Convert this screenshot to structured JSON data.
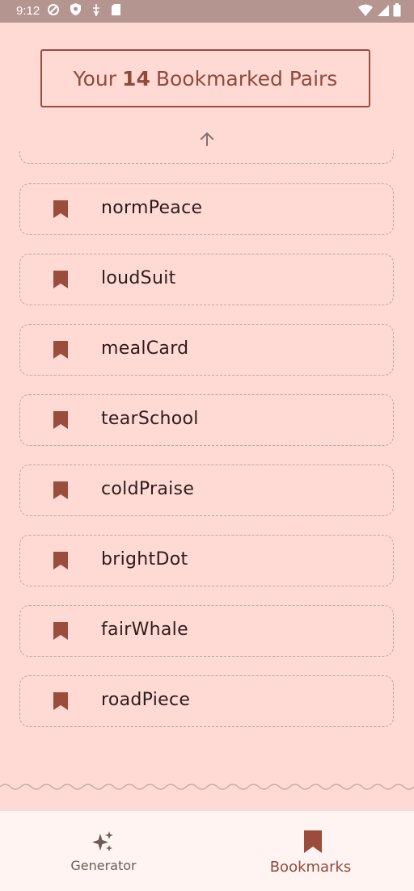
{
  "status_bar": {
    "time": "9:12"
  },
  "header": {
    "title_prefix": "Your",
    "bookmark_count": "14",
    "title_suffix": "Bookmarked Pairs"
  },
  "bookmarks": [
    {
      "label": "normPeace"
    },
    {
      "label": "loudSuit"
    },
    {
      "label": "mealCard"
    },
    {
      "label": "tearSchool"
    },
    {
      "label": "coldPraise"
    },
    {
      "label": "brightDot"
    },
    {
      "label": "fairWhale"
    },
    {
      "label": "roadPiece"
    }
  ],
  "bottom_nav": {
    "generator_label": "Generator",
    "generator_icon": "sparkles-icon",
    "bookmarks_label": "Bookmarks",
    "bookmarks_icon": "bookmark-icon",
    "selected": "bookmarks"
  },
  "colors": {
    "background": "#ffdad4",
    "accent": "#9a4c3d",
    "nav_background": "#fff4f2",
    "status_bar": "#b5958f"
  }
}
